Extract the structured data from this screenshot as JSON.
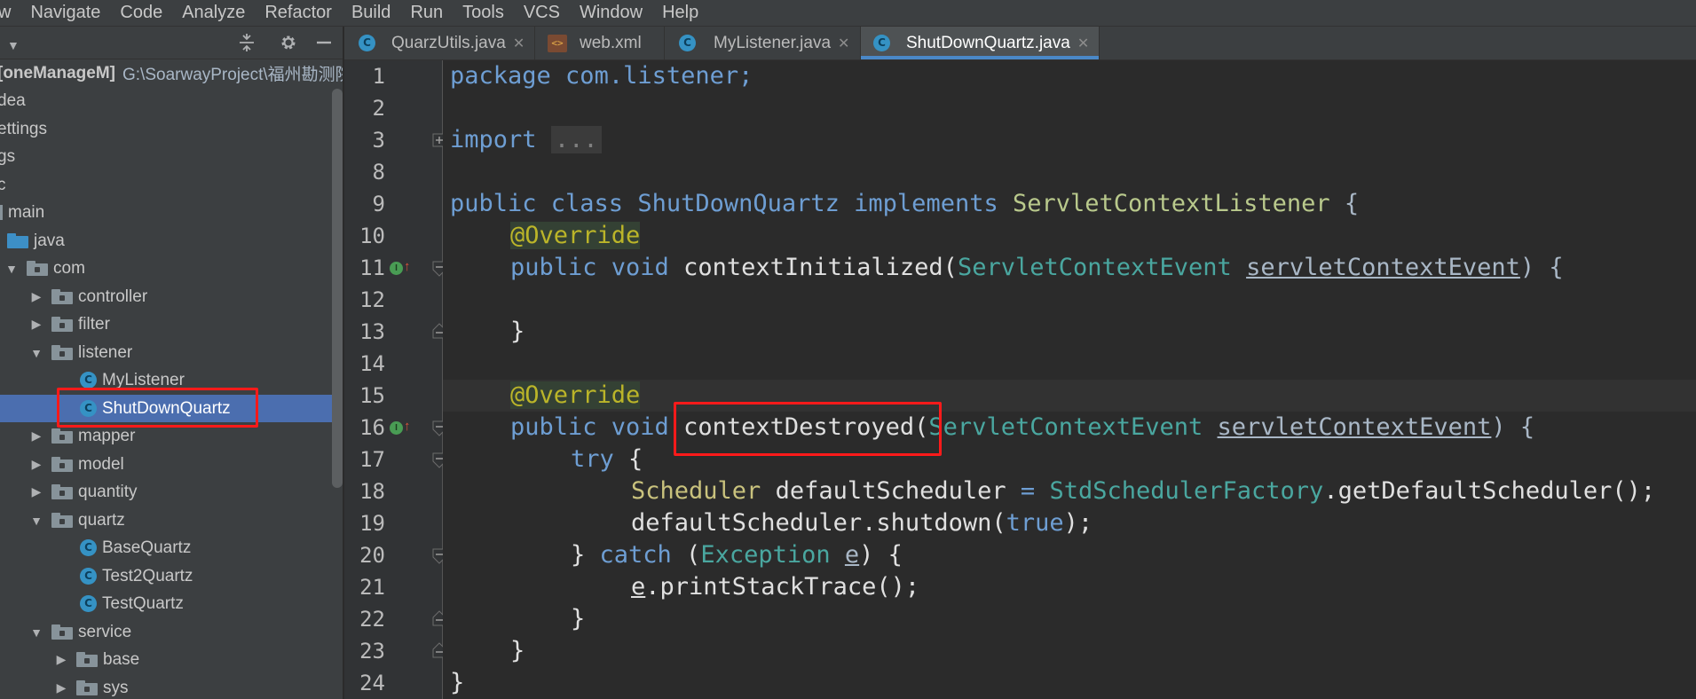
{
  "menu": [
    "w",
    "Navigate",
    "Code",
    "Analyze",
    "Refactor",
    "Build",
    "Run",
    "Tools",
    "VCS",
    "Window",
    "Help"
  ],
  "project": {
    "root_label": "[oneManageM]",
    "root_path": "G:\\SoarwayProject\\福州勘测院",
    "tree": [
      {
        "label": "dea",
        "indent": 0
      },
      {
        "label": "ettings",
        "indent": 0
      },
      {
        "label": "gs",
        "indent": 0
      },
      {
        "label": "c",
        "indent": 0
      },
      {
        "label": "main",
        "indent": 0
      },
      {
        "label": "java",
        "indent": 1
      },
      {
        "label": "com",
        "indent": 2
      },
      {
        "label": "controller",
        "indent": 3
      },
      {
        "label": "filter",
        "indent": 3
      },
      {
        "label": "listener",
        "indent": 3
      },
      {
        "label": "MyListener",
        "indent": 4
      },
      {
        "label": "ShutDownQuartz",
        "indent": 4
      },
      {
        "label": "mapper",
        "indent": 3
      },
      {
        "label": "model",
        "indent": 3
      },
      {
        "label": "quantity",
        "indent": 3
      },
      {
        "label": "quartz",
        "indent": 3
      },
      {
        "label": "BaseQuartz",
        "indent": 4
      },
      {
        "label": "Test2Quartz",
        "indent": 4
      },
      {
        "label": "TestQuartz",
        "indent": 4
      },
      {
        "label": "service",
        "indent": 3
      },
      {
        "label": "base",
        "indent": 4
      },
      {
        "label": "sys",
        "indent": 4
      }
    ]
  },
  "tabs": [
    {
      "label": "QuarzUtils.java",
      "icon": "class-icon",
      "active": false
    },
    {
      "label": "web.xml",
      "icon": "xml-file-icon",
      "active": false
    },
    {
      "label": "MyListener.java",
      "icon": "class-icon",
      "active": false
    },
    {
      "label": "ShutDownQuartz.java",
      "icon": "class-icon",
      "active": true
    }
  ],
  "line_numbers": [
    "1",
    "2",
    "3",
    "8",
    "9",
    "10",
    "11",
    "12",
    "13",
    "14",
    "15",
    "16",
    "17",
    "18",
    "19",
    "20",
    "21",
    "22",
    "23",
    "24"
  ],
  "code": {
    "l1_kw": "package",
    "l1_rest": " com.listener;",
    "l3_kw": "import",
    "l3_fold": "...",
    "l9_a": "public class ",
    "l9_cls": "ShutDownQuartz",
    "l9_b": " implements ",
    "l9_ifc": "ServletContextListener",
    "l9_c": " {",
    "l10_ann": "@Override",
    "l11_a": "public void ",
    "l11_m": "contextInitialized(",
    "l11_t": "ServletContextEvent",
    "l11_p": "servletContextEvent",
    "l11_c": ") {",
    "l13": "}",
    "l15_ann": "@Override",
    "l16_a": "public void ",
    "l16_m": "contextDestroyed(",
    "l16_t": "ServletContextEvent",
    "l16_p": "servletContextEvent",
    "l16_c": ") {",
    "l17_kw": "try",
    "l17_c": " {",
    "l18_t": "Scheduler",
    "l18_v": " defaultScheduler ",
    "l18_eq": "=",
    "l18_f": "StdSchedulerFactory",
    "l18_m": ".getDefaultScheduler();",
    "l19_a": "defaultScheduler.shutdown(",
    "l19_b": "true",
    "l19_c": ");",
    "l20_a": "} ",
    "l20_kw": "catch",
    "l20_b": " (",
    "l20_t": "Exception",
    "l20_p": "e",
    "l20_c": ") {",
    "l21_p": "e",
    "l21_c": ".printStackTrace();",
    "l22": "}",
    "l23": "}",
    "l24": "}"
  },
  "colors": {
    "highlight_box": "#ff1a1a",
    "selection": "#4b6eaf"
  }
}
